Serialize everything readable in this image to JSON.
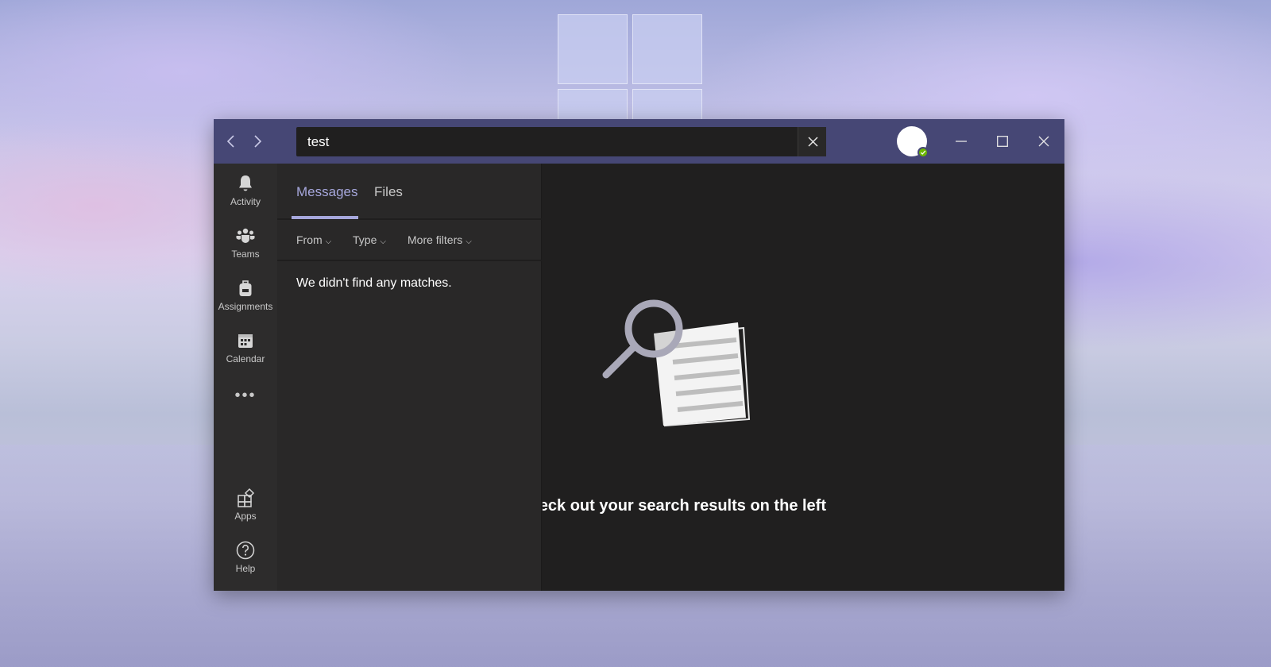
{
  "titlebar": {
    "back_icon": "chevron-left-icon",
    "forward_icon": "chevron-right-icon",
    "search_value": "test",
    "clear_icon": "close-icon",
    "presence_status": "available",
    "window_controls": [
      "minimize-icon",
      "maximize-icon",
      "close-icon"
    ]
  },
  "rail": {
    "items": [
      {
        "label": "Activity",
        "icon": "bell-icon"
      },
      {
        "label": "Teams",
        "icon": "teams-icon"
      },
      {
        "label": "Assignments",
        "icon": "backpack-icon"
      },
      {
        "label": "Calendar",
        "icon": "calendar-icon"
      },
      {
        "label": "Apps",
        "icon": "apps-icon"
      },
      {
        "label": "Help",
        "icon": "help-icon"
      }
    ],
    "more_label": "•••"
  },
  "panel": {
    "tabs": [
      {
        "label": "Messages",
        "active": true
      },
      {
        "label": "Files",
        "active": false
      }
    ],
    "filters": [
      {
        "label": "From"
      },
      {
        "label": "Type"
      },
      {
        "label": "More filters"
      }
    ],
    "no_results": "We didn't find any matches."
  },
  "content": {
    "illustration": "search-document-icon",
    "message": "eck out your search results on the left"
  },
  "colors": {
    "titlebar": "#464775",
    "accent": "#a6a7dc",
    "rail": "#2d2c2c",
    "panel": "#292828",
    "content": "#201f1f",
    "presence": "#6bb700"
  }
}
